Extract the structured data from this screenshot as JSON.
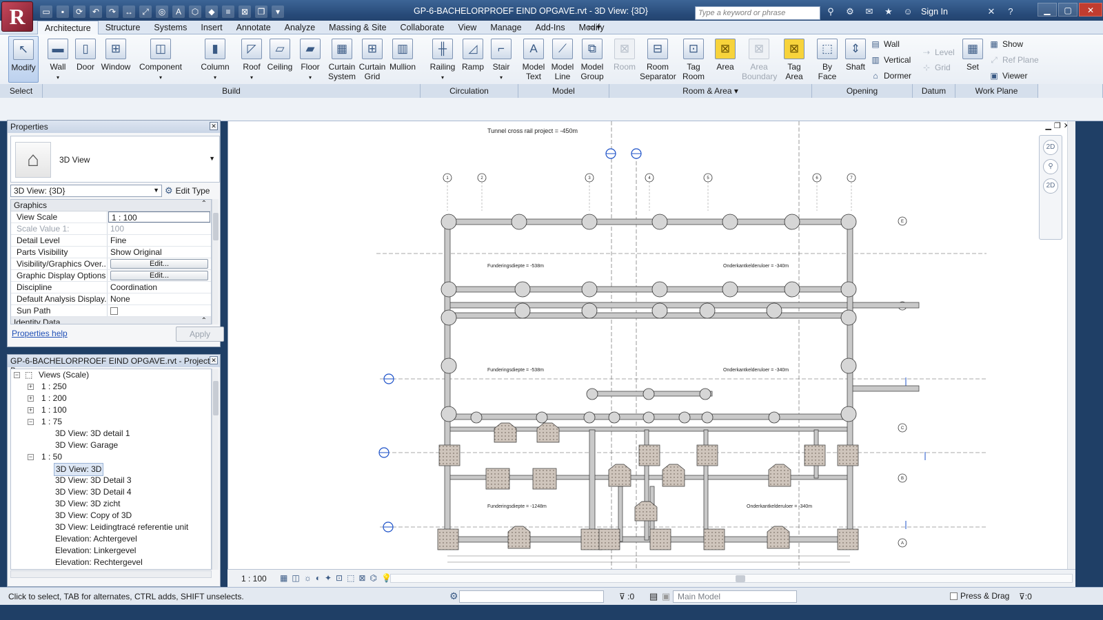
{
  "app": {
    "logo": "R",
    "title": "GP-6-BACHELORPROEF EIND OPGAVE.rvt - 3D View: {3D}",
    "search_placeholder": "Type a keyword or phrase",
    "sign_in": "Sign In"
  },
  "ribbon": {
    "tabs": [
      "Architecture",
      "Structure",
      "Systems",
      "Insert",
      "Annotate",
      "Analyze",
      "Massing & Site",
      "Collaborate",
      "View",
      "Manage",
      "Add-Ins",
      "Modify"
    ],
    "active_tab": "Architecture",
    "buttons": {
      "modify": "Modify",
      "wall": "Wall",
      "door": "Door",
      "window": "Window",
      "component": "Component",
      "column": "Column",
      "roof": "Roof",
      "ceiling": "Ceiling",
      "floor": "Floor",
      "curtain_system": "Curtain System",
      "curtain_grid": "Curtain Grid",
      "mullion": "Mullion",
      "railing": "Railing",
      "ramp": "Ramp",
      "stair": "Stair",
      "model_text": "Model Text",
      "model_line": "Model Line",
      "model_group": "Model Group",
      "room": "Room",
      "room_separator": "Room Separator",
      "tag_room": "Tag Room",
      "area": "Area",
      "area_boundary": "Area Boundary",
      "tag_area": "Tag Area",
      "by_face": "By Face",
      "shaft": "Shaft",
      "wall_small": "Wall",
      "vertical": "Vertical",
      "dormer": "Dormer",
      "level": "Level",
      "grid": "Grid",
      "set": "Set",
      "show": "Show",
      "ref_plane": "Ref Plane",
      "viewer": "Viewer"
    },
    "groups": {
      "select": "Select",
      "build": "Build",
      "circulation": "Circulation",
      "model": "Model",
      "room_area": "Room & Area ▾",
      "opening": "Opening",
      "datum": "Datum",
      "work_plane": "Work Plane"
    }
  },
  "properties": {
    "title": "Properties",
    "type_name": "3D View",
    "instance": "3D View: {3D}",
    "edit_type": "Edit Type",
    "groups": {
      "graphics": "Graphics",
      "identity": "Identity Data"
    },
    "rows": [
      {
        "name": "View Scale",
        "value": "1 : 100"
      },
      {
        "name": "Scale Value    1:",
        "value": "100"
      },
      {
        "name": "Detail Level",
        "value": "Fine"
      },
      {
        "name": "Parts Visibility",
        "value": "Show Original"
      },
      {
        "name": "Visibility/Graphics Over...",
        "value": "Edit..."
      },
      {
        "name": "Graphic Display Options",
        "value": "Edit..."
      },
      {
        "name": "Discipline",
        "value": "Coordination"
      },
      {
        "name": "Default Analysis Display...",
        "value": "None"
      },
      {
        "name": "Sun Path",
        "value": ""
      }
    ],
    "help": "Properties help",
    "apply": "Apply"
  },
  "browser": {
    "title": "GP-6-BACHELORPROEF EIND OPGAVE.rvt - Project Bro...",
    "root": "Views (Scale)",
    "scales": [
      "1 : 250",
      "1 : 200",
      "1 : 100",
      "1 : 75",
      "1 : 50"
    ],
    "views_75": [
      "3D View: 3D detail 1",
      "3D View: Garage"
    ],
    "views_50": [
      "3D View: 3D",
      "3D View: 3D Detail 3",
      "3D View: 3D Detail 4",
      "3D View: 3D zicht",
      "3D View: Copy of 3D",
      "3D View: Leidingtracé referentie unit",
      "Elevation: Achtergevel",
      "Elevation: Linkergevel",
      "Elevation: Rechtergevel"
    ]
  },
  "drawing": {
    "heading": "Tunnel cross rail project = -450m",
    "labels": {
      "fund1": "Funderingsdiepte = -538m",
      "onder1": "Onderkantkelderuloer = -340m",
      "fund2": "Funderingsdiepte = -538m",
      "onder2": "Onderkantkelderuloer = -340m",
      "fund3": "Funderingsdiepte = -1248m",
      "onder3": "Onderkantkelderuloer = -340m"
    },
    "grid_top": [
      "1",
      "2",
      "3",
      "4",
      "5",
      "6",
      "7"
    ],
    "grid_right": [
      "E",
      "D",
      "C",
      "B",
      "A"
    ]
  },
  "viewbar": {
    "scale": "1 : 100"
  },
  "status": {
    "message": "Click to select, TAB for alternates, CTRL adds, SHIFT unselects.",
    "zero": ":0",
    "model": "Main Model",
    "press_drag": "Press & Drag",
    "filter": ":0"
  }
}
